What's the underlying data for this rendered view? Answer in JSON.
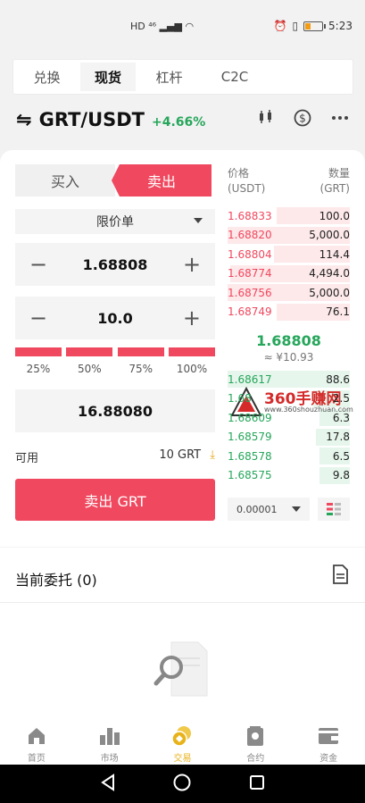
{
  "status_bar": {
    "network": "HD ⁴⁶",
    "time": "5:23",
    "battery_level": 0.35
  },
  "tabs": [
    {
      "label": "兑换",
      "active": false
    },
    {
      "label": "现货",
      "active": true
    },
    {
      "label": "杠杆",
      "active": false
    },
    {
      "label": "C2C",
      "active": false
    }
  ],
  "pair": {
    "swap_icon": "⇋",
    "symbol": "GRT/USDT",
    "change": "+4.66%"
  },
  "header_icons": [
    "chart-icon",
    "dollar-circle-icon",
    "more-icon"
  ],
  "trade": {
    "buy_label": "买入",
    "sell_label": "卖出",
    "order_type": "限价单",
    "price": "1.68808",
    "amount": "10.0",
    "minus": "−",
    "plus": "+",
    "percent_options": [
      "25%",
      "50%",
      "75%",
      "100%"
    ],
    "total": "16.88080",
    "available_label": "可用",
    "available_value": "10 GRT",
    "submit_label": "卖出 GRT"
  },
  "orderbook": {
    "price_header": "价格",
    "price_unit": "(USDT)",
    "qty_header": "数量",
    "qty_unit": "(GRT)",
    "asks": [
      {
        "price": "1.68833",
        "qty": "100.0",
        "depth": 0.6
      },
      {
        "price": "1.68820",
        "qty": "5,000.0",
        "depth": 1.0
      },
      {
        "price": "1.68804",
        "qty": "114.4",
        "depth": 0.62
      },
      {
        "price": "1.68774",
        "qty": "4,494.0",
        "depth": 0.98
      },
      {
        "price": "1.68756",
        "qty": "5,000.0",
        "depth": 1.0
      },
      {
        "price": "1.68749",
        "qty": "76.1",
        "depth": 0.6
      }
    ],
    "mid_price": "1.68808",
    "mid_cny": "≈ ¥10.93",
    "bids": [
      {
        "price": "1.68617",
        "qty": "88.6",
        "depth": 1.0
      },
      {
        "price": "1.68",
        "qty": "2.5",
        "depth": 0.3
      },
      {
        "price": "1.68609",
        "qty": "6.3",
        "depth": 0.25
      },
      {
        "price": "1.68579",
        "qty": "17.8",
        "depth": 0.28
      },
      {
        "price": "1.68578",
        "qty": "6.5",
        "depth": 0.25
      },
      {
        "price": "1.68575",
        "qty": "9.8",
        "depth": 0.25
      }
    ],
    "depth_precision": "0.00001"
  },
  "watermark": {
    "title": "360手赚网",
    "url": "www.360shouzhuan.com"
  },
  "orders": {
    "title": "当前委托 (0)"
  },
  "bottom_nav": [
    {
      "label": "首页",
      "icon": "home-icon",
      "active": false
    },
    {
      "label": "市场",
      "icon": "market-icon",
      "active": false
    },
    {
      "label": "交易",
      "icon": "trade-icon",
      "active": true
    },
    {
      "label": "合约",
      "icon": "futures-icon",
      "active": false
    },
    {
      "label": "资金",
      "icon": "wallet-icon",
      "active": false
    }
  ],
  "colors": {
    "sell": "#f0485e",
    "buy": "#26a65b",
    "active_nav": "#e8b21a"
  }
}
